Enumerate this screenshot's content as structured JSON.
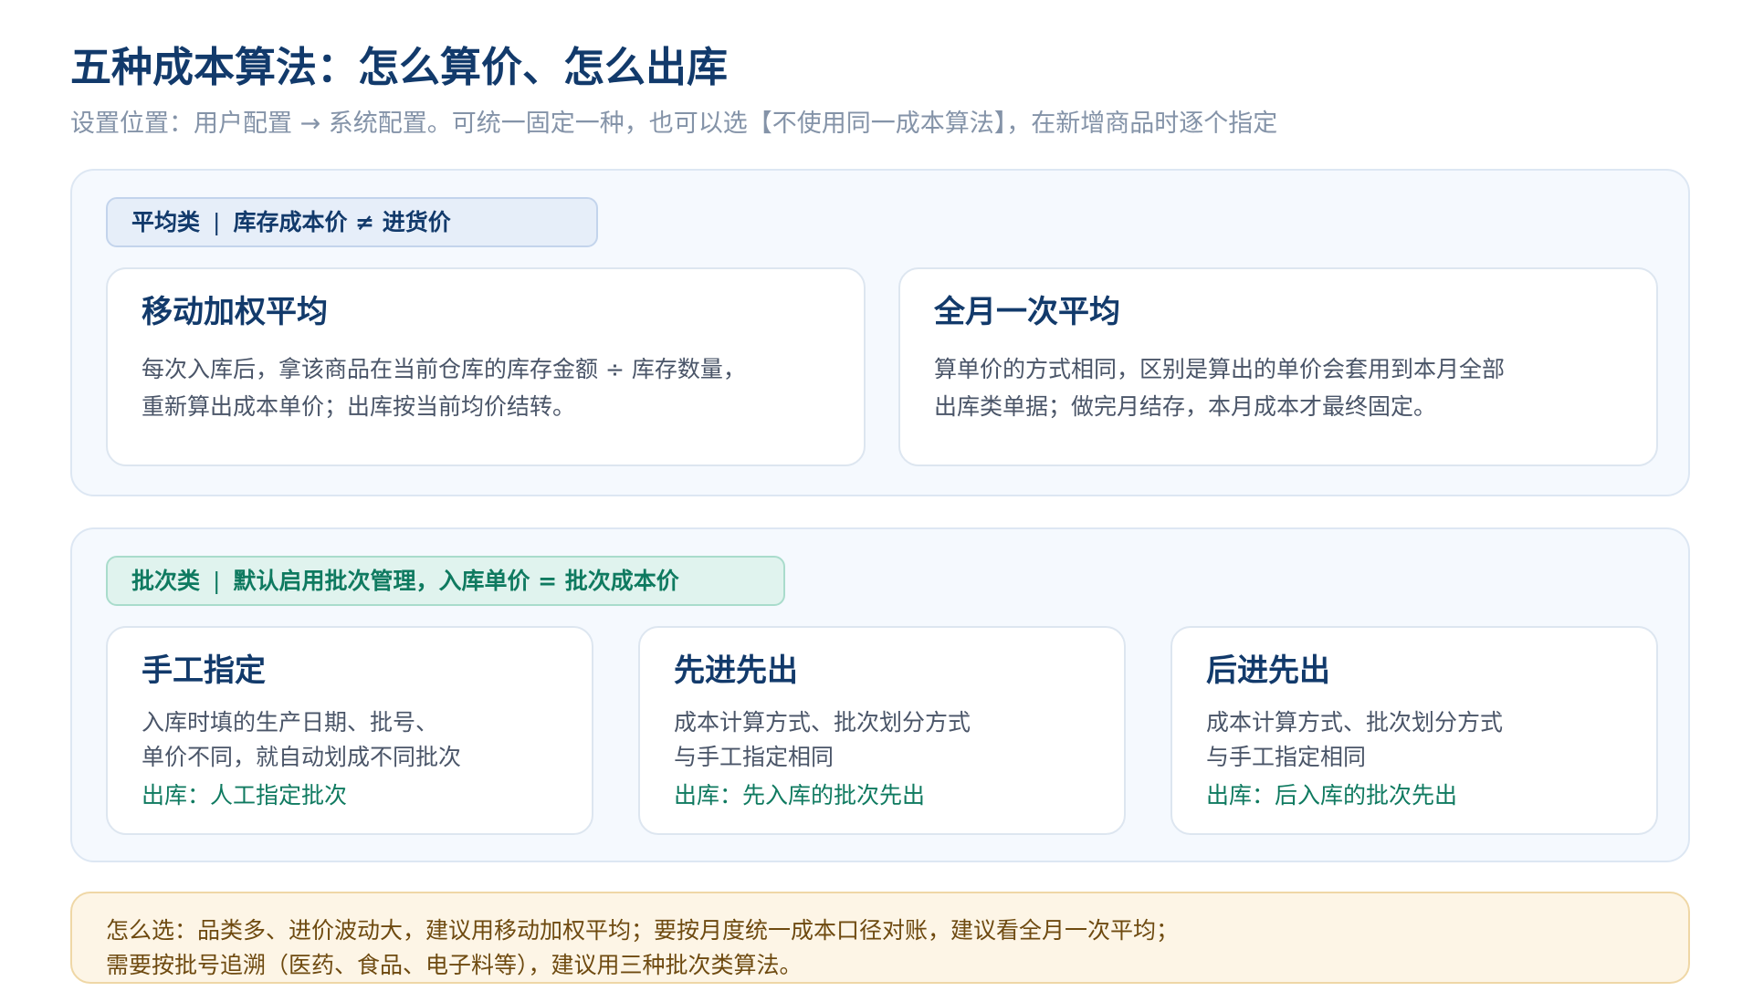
{
  "title": "五种成本算法：怎么算价、怎么出库",
  "subtitle": "设置位置：用户配置 → 系统配置。可统一固定一种，也可以选【不使用同一成本算法】，在新增商品时逐个指定",
  "average_section": {
    "tag_category": "平均类",
    "tag_separator": "|",
    "tag_note": "库存成本价 ≠ 进货价",
    "cards": [
      {
        "title": "移动加权平均",
        "desc_lines": [
          "每次入库后，拿该商品在当前仓库的库存金额 ÷ 库存数量，",
          "重新算出成本单价；出库按当前均价结转。"
        ]
      },
      {
        "title": "全月一次平均",
        "desc_lines": [
          "算单价的方式相同，区别是算出的单价会套用到本月全部",
          "出库类单据；做完月结存，本月成本才最终固定。"
        ]
      }
    ]
  },
  "batch_section": {
    "tag_category": "批次类",
    "tag_separator": "|",
    "tag_note": "默认启用批次管理，入库单价 = 批次成本价",
    "cards": [
      {
        "title": "手工指定",
        "desc_lines": [
          "入库时填的生产日期、批号、",
          "单价不同，就自动划成不同批次"
        ],
        "outbound": "出库：人工指定批次"
      },
      {
        "title": "先进先出",
        "desc_lines": [
          "成本计算方式、批次划分方式",
          "与手工指定相同"
        ],
        "outbound": "出库：先入库的批次先出"
      },
      {
        "title": "后进先出",
        "desc_lines": [
          "成本计算方式、批次划分方式",
          "与手工指定相同"
        ],
        "outbound": "出库：后入库的批次先出"
      }
    ]
  },
  "tip_lines": [
    "怎么选：品类多、进价波动大，建议用移动加权平均；要按月度统一成本口径对账，建议看全月一次平均；",
    "需要按批号追溯（医药、食品、电子料等），建议用三种批次类算法。"
  ],
  "colors": {
    "title": "#123a6b",
    "subtitle": "#8493a8",
    "section_bg": "#f5f9fe",
    "green_accent": "#0f7a60",
    "tip_bg": "#fdf5e6",
    "tip_text": "#6e4a10"
  }
}
